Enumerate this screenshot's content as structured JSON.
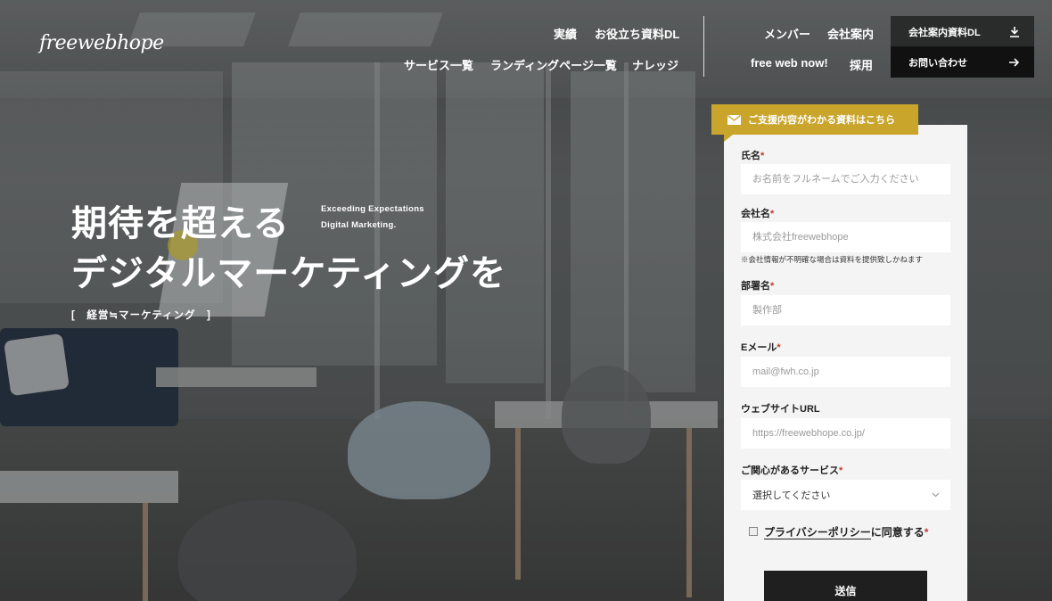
{
  "brand": {
    "logo_text": "freewebhope"
  },
  "nav": {
    "top_row": [
      "実績",
      "お役立ち資料DL"
    ],
    "bottom_row": [
      "サービス一覧",
      "ランディングページ一覧",
      "ナレッジ"
    ],
    "right_top": [
      "メンバー",
      "会社案内"
    ],
    "right_bottom": [
      "free web now!",
      "採用"
    ],
    "download_button": {
      "label": "会社案内資料DL",
      "icon": "download-icon"
    },
    "contact_button": {
      "label": "お問い合わせ",
      "icon": "arrow-right-icon"
    }
  },
  "hero": {
    "title_line1": "期待を超える",
    "title_line2": "デジタルマーケティングを",
    "subtitle_line1": "Exceeding Expectations",
    "subtitle_line2": "Digital Marketing.",
    "tagline": "[　経営≒マーケティング　]"
  },
  "form": {
    "tab_label": "ご支援内容がわかる資料はこちら",
    "tab_icon": "mail-icon",
    "fields": [
      {
        "label": "氏名",
        "required": "*",
        "placeholder": "お名前をフルネームでご入力ください"
      },
      {
        "label": "会社名",
        "required": "*",
        "placeholder": "株式会社freewebhope"
      },
      {
        "label": "部署名",
        "required": "*",
        "placeholder": "製作部"
      },
      {
        "label": "Eメール",
        "required": "*",
        "placeholder": "mail@fwh.co.jp"
      },
      {
        "label": "ウェブサイトURL",
        "required": "",
        "placeholder": "https://freewebhope.co.jp/"
      }
    ],
    "company_note": "※会社情報が不明確な場合は資料を提供致しかねます",
    "service": {
      "label": "ご関心があるサービス",
      "required": "*",
      "selected": "選択してください"
    },
    "privacy": {
      "link_text": "プライバシーポリシー",
      "suffix": "に同意する",
      "required": "*"
    },
    "submit_label": "送信"
  },
  "colors": {
    "accent": "#c9a52c",
    "dark_button": "#1e1f1f",
    "required": "#c0392b"
  }
}
